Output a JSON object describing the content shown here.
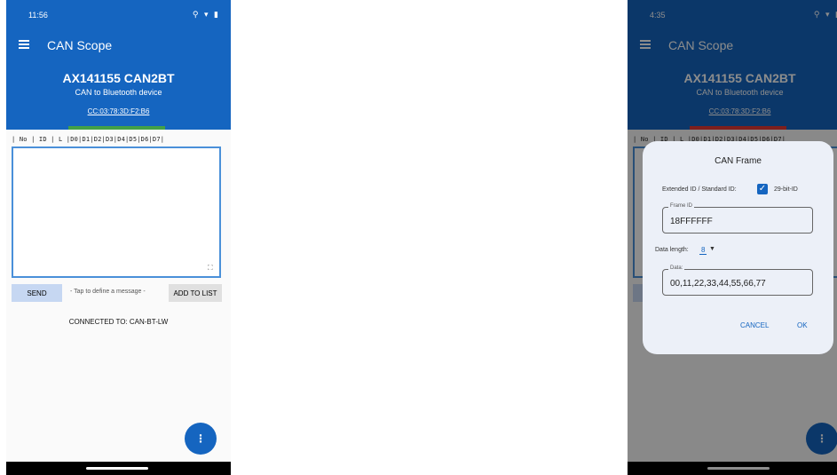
{
  "colors": {
    "primary": "#1565c0",
    "connected_green": "#43a047",
    "disconnected_red": "#e53935"
  },
  "left_screen": {
    "status": {
      "time": "11:56",
      "icons": "⚲ ▾ ▮"
    },
    "app_title": "CAN Scope",
    "device": {
      "name": "AX141155 CAN2BT",
      "description": "CAN to Bluetooth device",
      "mac": "CC:03:78:3D:F2:B6"
    },
    "table_header": "| No |   ID   | L |D0|D1|D2|D3|D4|D5|D6|D7|",
    "send_label": "SEND",
    "hint": "- Tap to define a message -",
    "add_label": "ADD TO LIST",
    "connected": "CONNECTED TO: CAN-BT-LW",
    "fab_icon": "⋮"
  },
  "right_screen": {
    "status": {
      "time": "4:35",
      "icons": "⚲ ▾ ▮"
    },
    "app_title": "CAN Scope",
    "device": {
      "name": "AX141155 CAN2BT",
      "description": "CAN to Bluetooth device",
      "mac": "CC:03:78:3D:F2:B6"
    },
    "table_header": "| No |   ID   | L |D0|D1|D2|D3|D4|D5|D6|D7|",
    "fab_icon": "⋮",
    "dialog": {
      "title": "CAN Frame",
      "ext_label": "Extended ID / Standard ID:",
      "checkbox_checked": true,
      "bit_label": "29-bit-ID",
      "frame_id_legend": "Frame ID",
      "frame_id_value": "18FFFFFF",
      "data_length_label": "Data length:",
      "data_length_value": "8",
      "data_legend": "Data:",
      "data_value": "00,11,22,33,44,55,66,77",
      "cancel_label": "CANCEL",
      "ok_label": "OK"
    }
  }
}
